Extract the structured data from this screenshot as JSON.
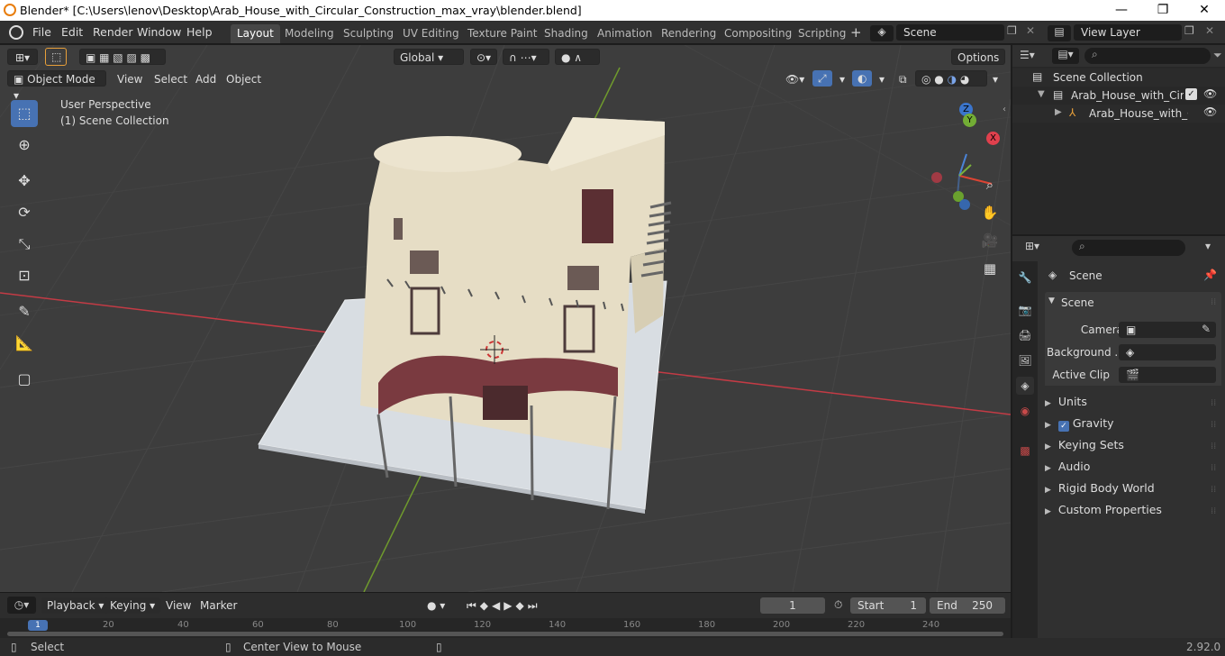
{
  "titlebar": {
    "title": "Blender* [C:\\Users\\lenov\\Desktop\\Arab_House_with_Circular_Construction_max_vray\\blender.blend]",
    "minimize": "—",
    "maximize": "❐",
    "close": "✕"
  },
  "menus": [
    "File",
    "Edit",
    "Render",
    "Window",
    "Help"
  ],
  "workspaces": [
    "Layout",
    "Modeling",
    "Sculpting",
    "UV Editing",
    "Texture Paint",
    "Shading",
    "Animation",
    "Rendering",
    "Compositing",
    "Scripting"
  ],
  "scene_field": "Scene",
  "view_layer_field": "View Layer",
  "toolheader": {
    "orientation": "Global",
    "options": "Options"
  },
  "viewport_header": {
    "mode": "Object Mode",
    "menus": [
      "View",
      "Select",
      "Add",
      "Object"
    ]
  },
  "viewport": {
    "perspective_label": "User Perspective",
    "collection_label": "(1) Scene Collection",
    "gizmo": {
      "x": "X",
      "y": "Y",
      "z": "Z"
    }
  },
  "outliner": {
    "root": "Scene Collection",
    "item1": "Arab_House_with_Circula",
    "item2": "Arab_House_with_Ci"
  },
  "properties": {
    "header": "Scene",
    "panel": "Scene",
    "camera_label": "Camera",
    "background_label": "Background ...",
    "active_clip_label": "Active Clip",
    "sections": [
      "Units",
      "Gravity",
      "Keying Sets",
      "Audio",
      "Rigid Body World",
      "Custom Properties"
    ]
  },
  "timeline": {
    "menus": [
      "Playback",
      "Keying",
      "View",
      "Marker"
    ],
    "current_frame": "1",
    "start_label": "Start",
    "start_value": "1",
    "end_label": "End",
    "end_value": "250",
    "ruler": [
      "1",
      "20",
      "40",
      "60",
      "80",
      "100",
      "120",
      "140",
      "160",
      "180",
      "200",
      "220",
      "240"
    ]
  },
  "statusbar": {
    "select": "Select",
    "center": "Center View to Mouse",
    "version": "2.92.0"
  },
  "colors": {
    "accent": "#4772b3",
    "wall": "#e8dfc6",
    "awning": "#7a3a40",
    "ground": "#dfe3e8"
  }
}
